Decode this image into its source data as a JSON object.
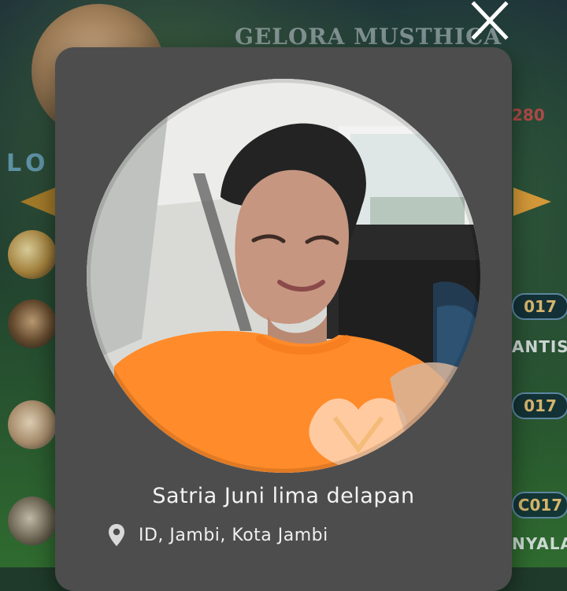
{
  "background": {
    "title": "GELORA MUSTHICA",
    "left_label": "LO",
    "count_text": "280",
    "pills": [
      "017",
      "017",
      "C017"
    ],
    "captions": [
      "ANTIS",
      "NYALA"
    ],
    "colors": {
      "title": "#c9d2da",
      "count": "#d24a4a",
      "pill_text": "#d6b56c",
      "pill_border": "#5d86a2"
    }
  },
  "modal": {
    "close_icon": "close-icon",
    "photo_icon": "profile-photo",
    "name": "Satria Juni lima delapan",
    "location_icon": "map-pin-icon",
    "location": "ID, Jambi, Kota Jambi",
    "colors": {
      "card_bg": "#4d4d4d",
      "text": "#f3f3f3",
      "accent": "#ff8b2a"
    }
  }
}
